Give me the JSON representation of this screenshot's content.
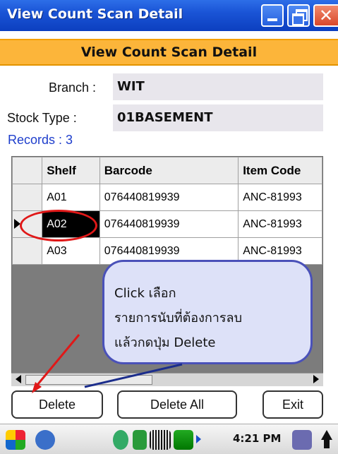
{
  "window": {
    "title": "View Count Scan Detail"
  },
  "header": {
    "title": "View Count Scan Detail"
  },
  "fields": {
    "branch_label": "Branch :",
    "branch_value": "WIT",
    "stock_type_label": "Stock Type :",
    "stock_type_value": "01BASEMENT",
    "records_text": "Records : 3"
  },
  "grid": {
    "columns": [
      "Shelf",
      "Barcode",
      "Item Code"
    ],
    "rows": [
      {
        "shelf": "A01",
        "barcode": "076440819939",
        "item_code": "ANC-81993"
      },
      {
        "shelf": "A02",
        "barcode": "076440819939",
        "item_code": "ANC-81993"
      },
      {
        "shelf": "A03",
        "barcode": "076440819939",
        "item_code": "ANC-81993"
      }
    ],
    "selected_row": 1
  },
  "buttons": {
    "delete": "Delete",
    "delete_all": "Delete All",
    "exit": "Exit"
  },
  "taskbar": {
    "clock": "4:21 PM"
  },
  "annotation": {
    "lines": [
      "Click เลือก",
      "รายการนับที่ต้องการลบ",
      "แล้วกดปุ่ม Delete"
    ]
  },
  "colors": {
    "titlebar": "#1a54d6",
    "header_band": "#fcb53a",
    "records_text": "#1e3ecc",
    "annotation_border": "#4a51b9",
    "highlight_ellipse": "#e01818"
  }
}
